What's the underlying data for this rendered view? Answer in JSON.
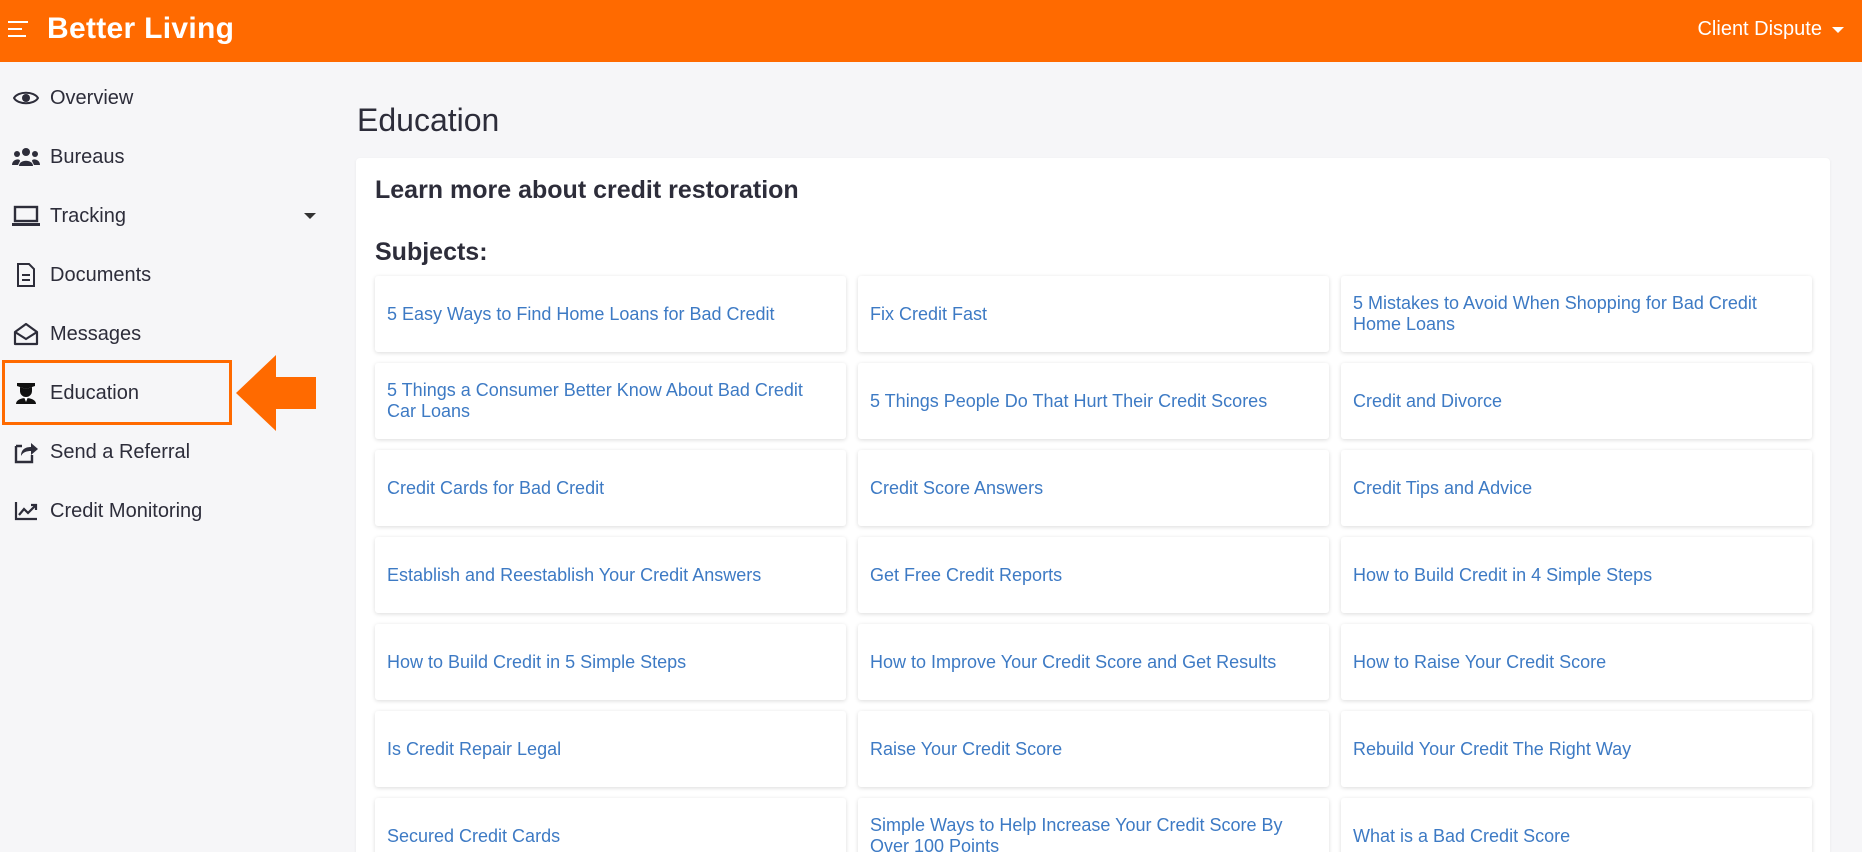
{
  "header": {
    "brand": "Better Living",
    "client_menu": "Client Dispute"
  },
  "sidebar": {
    "items": [
      {
        "label": "Overview",
        "icon": "eye-icon"
      },
      {
        "label": "Bureaus",
        "icon": "users-icon"
      },
      {
        "label": "Tracking",
        "icon": "laptop-icon",
        "has_caret": true
      },
      {
        "label": "Documents",
        "icon": "document-icon"
      },
      {
        "label": "Messages",
        "icon": "envelope-open-icon"
      },
      {
        "label": "Education",
        "icon": "graduate-icon",
        "active": true
      },
      {
        "label": "Send a Referral",
        "icon": "share-icon"
      },
      {
        "label": "Credit Monitoring",
        "icon": "chart-line-icon"
      }
    ]
  },
  "main": {
    "page_title": "Education",
    "card_title": "Learn more about credit restoration",
    "subjects_label": "Subjects:",
    "subjects": [
      "5 Easy Ways to Find Home Loans for Bad Credit",
      "Fix Credit Fast",
      "5 Mistakes to Avoid When Shopping for Bad Credit Home Loans",
      "5 Things a Consumer Better Know About Bad Credit Car Loans",
      "5 Things People Do That Hurt Their Credit Scores",
      "Credit and Divorce",
      "Credit Cards for Bad Credit",
      "Credit Score Answers",
      "Credit Tips and Advice",
      "Establish and Reestablish Your Credit Answers",
      "Get Free Credit Reports",
      "How to Build Credit in 4 Simple Steps",
      "How to Build Credit in 5 Simple Steps",
      "How to Improve Your Credit Score and Get Results",
      "How to Raise Your Credit Score",
      "Is Credit Repair Legal",
      "Raise Your Credit Score",
      "Rebuild Your Credit The Right Way",
      "Secured Credit Cards",
      "Simple Ways to Help Increase Your Credit Score By Over 100 Points",
      "What is a Bad Credit Score"
    ]
  },
  "colors": {
    "brand_orange": "#ff6a00",
    "link_blue": "#3d7ac4",
    "text_dark": "#2d2d3a"
  }
}
